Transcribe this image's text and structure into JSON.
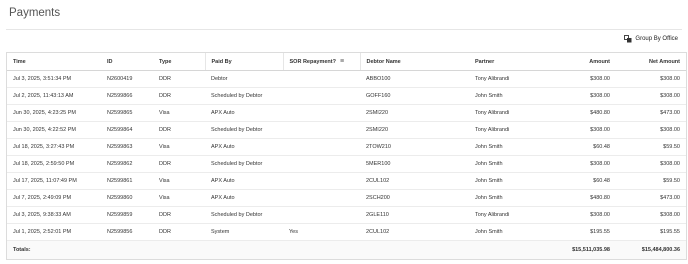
{
  "page": {
    "title": "Payments"
  },
  "toolbar": {
    "group_by_office_label": "Group By Office"
  },
  "table": {
    "columns": {
      "time": "Time",
      "id": "ID",
      "type": "Type",
      "paid_by": "Paid By",
      "sor_repayment": "SOR Repayment?",
      "debtor_name": "Debtor Name",
      "partner": "Partner",
      "amount": "Amount",
      "net_amount": "Net Amount"
    },
    "rows": [
      {
        "time": "Jul 3, 2025, 3:51:34 PM",
        "id": "N2600419",
        "type": "DDR",
        "paid_by": "Debtor",
        "sor": "",
        "debtor": "ABBO100",
        "partner": "Tony Alibrandi",
        "amount": "$308.00",
        "net": "$308.00"
      },
      {
        "time": "Jul 2, 2025, 11:43:13 AM",
        "id": "N2599866",
        "type": "DDR",
        "paid_by": "Scheduled by Debtor",
        "sor": "",
        "debtor": "GOFF160",
        "partner": "John Smith",
        "amount": "$308.00",
        "net": "$308.00"
      },
      {
        "time": "Jun 30, 2025, 4:23:25 PM",
        "id": "N2599865",
        "type": "Visa",
        "paid_by": "APX Auto",
        "sor": "",
        "debtor": "2SMI220",
        "partner": "Tony Alibrandi",
        "amount": "$480.80",
        "net": "$473.00"
      },
      {
        "time": "Jun 30, 2025, 4:22:52 PM",
        "id": "N2599864",
        "type": "DDR",
        "paid_by": "Scheduled by Debtor",
        "sor": "",
        "debtor": "2SMI220",
        "partner": "Tony Alibrandi",
        "amount": "$308.00",
        "net": "$308.00"
      },
      {
        "time": "Jul 18, 2025, 3:27:43 PM",
        "id": "N2599863",
        "type": "Visa",
        "paid_by": "APX Auto",
        "sor": "",
        "debtor": "2TOW210",
        "partner": "John Smith",
        "amount": "$60.48",
        "net": "$59.50"
      },
      {
        "time": "Jul 18, 2025, 2:59:50 PM",
        "id": "N2599862",
        "type": "DDR",
        "paid_by": "Scheduled by Debtor",
        "sor": "",
        "debtor": "5MER100",
        "partner": "John Smith",
        "amount": "$308.00",
        "net": "$308.00"
      },
      {
        "time": "Jul 17, 2025, 11:07:49 PM",
        "id": "N2599861",
        "type": "Visa",
        "paid_by": "APX Auto",
        "sor": "",
        "debtor": "2CUL102",
        "partner": "John Smith",
        "amount": "$60.48",
        "net": "$59.50"
      },
      {
        "time": "Jul 7, 2025, 2:49:09 PM",
        "id": "N2599860",
        "type": "Visa",
        "paid_by": "APX Auto",
        "sor": "",
        "debtor": "2SCH200",
        "partner": "John Smith",
        "amount": "$480.80",
        "net": "$473.00"
      },
      {
        "time": "Jul 3, 2025, 9:38:33 AM",
        "id": "N2599859",
        "type": "DDR",
        "paid_by": "Scheduled by Debtor",
        "sor": "",
        "debtor": "2GLE110",
        "partner": "Tony Alibrandi",
        "amount": "$308.00",
        "net": "$308.00"
      },
      {
        "time": "Jul 1, 2025, 2:52:01 PM",
        "id": "N2599856",
        "type": "DDR",
        "paid_by": "System",
        "sor": "Yes",
        "debtor": "2CUL102",
        "partner": "John Smith",
        "amount": "$195.55",
        "net": "$195.55"
      }
    ],
    "totals": {
      "label": "Totals:",
      "amount": "$15,511,035.98",
      "net": "$15,484,800.36"
    }
  },
  "icons": {
    "group_by_office": "grid-icon",
    "sor_filter": "filter-lines-icon"
  }
}
